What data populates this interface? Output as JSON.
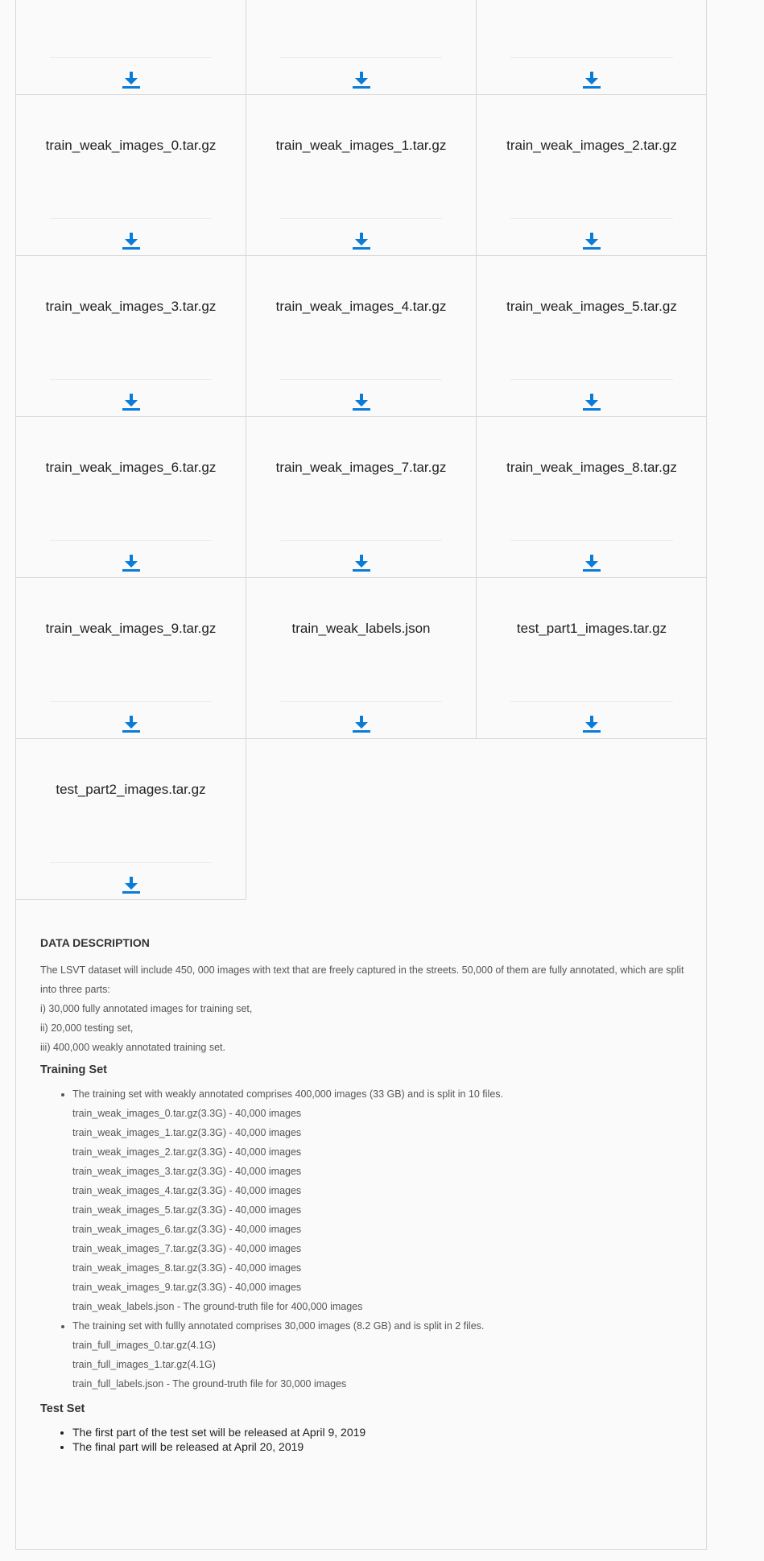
{
  "files": [
    {
      "name": ""
    },
    {
      "name": ""
    },
    {
      "name": ""
    },
    {
      "name": "train_weak_images_0.tar.gz"
    },
    {
      "name": "train_weak_images_1.tar.gz"
    },
    {
      "name": "train_weak_images_2.tar.gz"
    },
    {
      "name": "train_weak_images_3.tar.gz"
    },
    {
      "name": "train_weak_images_4.tar.gz"
    },
    {
      "name": "train_weak_images_5.tar.gz"
    },
    {
      "name": "train_weak_images_6.tar.gz"
    },
    {
      "name": "train_weak_images_7.tar.gz"
    },
    {
      "name": "train_weak_images_8.tar.gz"
    },
    {
      "name": "train_weak_images_9.tar.gz"
    },
    {
      "name": "train_weak_labels.json"
    },
    {
      "name": "test_part1_images.tar.gz"
    },
    {
      "name": "test_part2_images.tar.gz"
    }
  ],
  "accent_color": "#0a7bd6",
  "description": {
    "heading": "DATA DESCRIPTION",
    "intro": "The LSVT dataset will include 450, 000 images with text that are freely captured in the streets. 50,000 of them are fully annotated, which are split into three parts:",
    "parts": [
      "i) 30,000 fully annotated images for training set,",
      "ii) 20,000 testing set,",
      "iii) 400,000 weakly annotated training set."
    ],
    "training_heading": "Training Set",
    "weak_intro": "The training set with weakly annotated comprises 400,000 images (33 GB) and is split in 10 files.",
    "weak_files": [
      "train_weak_images_0.tar.gz(3.3G) - 40,000 images",
      "train_weak_images_1.tar.gz(3.3G) - 40,000 images",
      "train_weak_images_2.tar.gz(3.3G) - 40,000 images",
      "train_weak_images_3.tar.gz(3.3G) - 40,000 images",
      "train_weak_images_4.tar.gz(3.3G) - 40,000 images",
      "train_weak_images_5.tar.gz(3.3G) - 40,000 images",
      "train_weak_images_6.tar.gz(3.3G) - 40,000 images",
      "train_weak_images_7.tar.gz(3.3G) - 40,000 images",
      "train_weak_images_8.tar.gz(3.3G) - 40,000 images",
      "train_weak_images_9.tar.gz(3.3G) - 40,000 images",
      "train_weak_labels.json - The ground-truth file for 400,000 images"
    ],
    "full_intro": "The training set with fullly annotated comprises 30,000 images (8.2 GB) and is split in 2 files.",
    "full_files": [
      "train_full_images_0.tar.gz(4.1G)",
      "train_full_images_1.tar.gz(4.1G)",
      "train_full_labels.json - The ground-truth file for 30,000 images"
    ],
    "test_heading": "Test Set",
    "test_items": [
      "The first part of the test set will be released at April 9, 2019",
      "The final part will be released at April 20, 2019"
    ]
  }
}
